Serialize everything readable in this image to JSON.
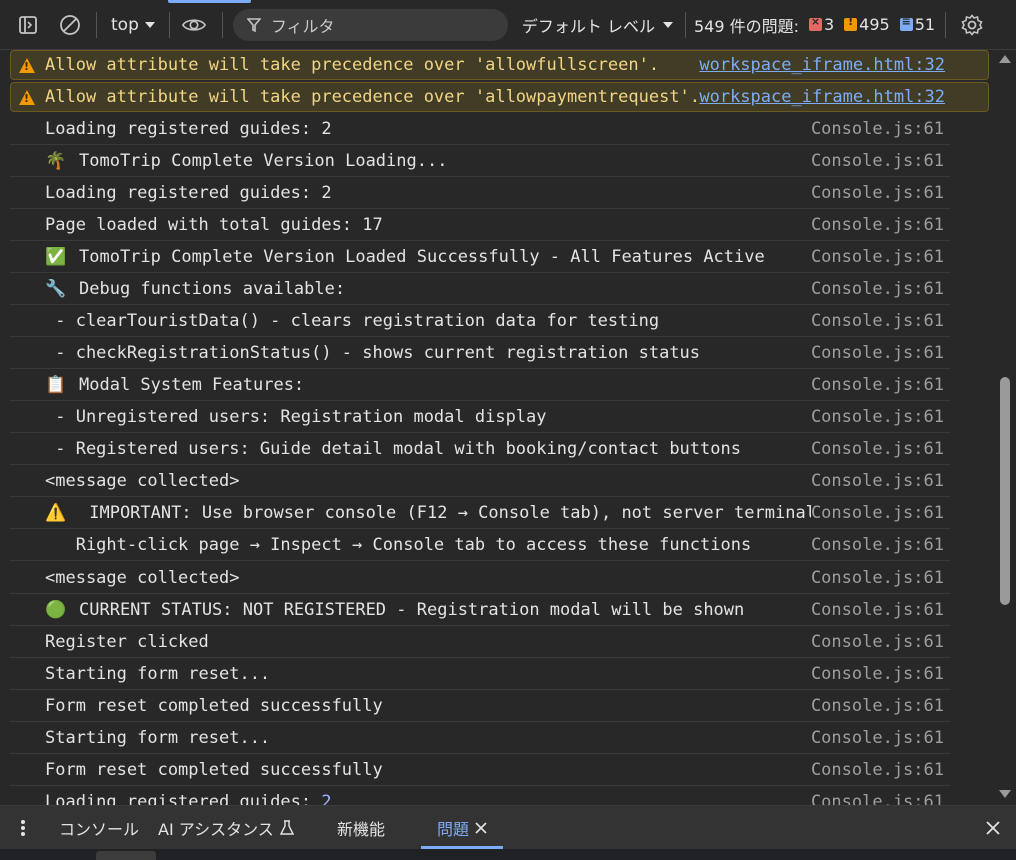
{
  "toolbar": {
    "context": "top",
    "filter_placeholder": "フィルタ",
    "level_label": "デフォルト レベル",
    "issues_label": "549 件の問題:",
    "issue_counts": {
      "error": "3",
      "warning": "495",
      "info": "51"
    }
  },
  "console": {
    "rows": [
      {
        "type": "warn",
        "text": "Allow attribute will take precedence over 'allowfullscreen'.",
        "source": "workspace_iframe.html:32"
      },
      {
        "type": "warn",
        "text": "Allow attribute will take precedence over 'allowpaymentrequest'.",
        "source": "workspace_iframe.html:32"
      },
      {
        "type": "log",
        "text": "Loading registered guides: 2",
        "source": "Console.js:61"
      },
      {
        "type": "log",
        "emoji": "🌴",
        "text": "TomoTrip Complete Version Loading...",
        "source": "Console.js:61"
      },
      {
        "type": "log",
        "text": "Loading registered guides: 2",
        "source": "Console.js:61"
      },
      {
        "type": "log",
        "text": "Page loaded with total guides: 17",
        "source": "Console.js:61"
      },
      {
        "type": "log",
        "emoji": "✅",
        "text": "TomoTrip Complete Version Loaded Successfully - All Features Active",
        "source": "Console.js:61"
      },
      {
        "type": "log",
        "emoji": "🔧",
        "text": "Debug functions available:",
        "source": "Console.js:61"
      },
      {
        "type": "log",
        "text": " - clearTouristData() - clears registration data for testing",
        "source": "Console.js:61"
      },
      {
        "type": "log",
        "text": " - checkRegistrationStatus() - shows current registration status",
        "source": "Console.js:61"
      },
      {
        "type": "log",
        "emoji": "📋",
        "text": "Modal System Features:",
        "source": "Console.js:61"
      },
      {
        "type": "log",
        "text": " - Unregistered users: Registration modal display",
        "source": "Console.js:61"
      },
      {
        "type": "log",
        "text": " - Registered users: Guide detail modal with booking/contact buttons",
        "source": "Console.js:61"
      },
      {
        "type": "log",
        "text": "<message collected>",
        "source": "Console.js:61"
      },
      {
        "type": "log",
        "emoji": "⚠️",
        "text": " IMPORTANT: Use browser console (F12 → Console tab), not server terminal",
        "source": "Console.js:61"
      },
      {
        "type": "log",
        "text": "   Right-click page → Inspect → Console tab to access these functions",
        "source": "Console.js:61"
      },
      {
        "type": "log",
        "text": "<message collected>",
        "source": "Console.js:61"
      },
      {
        "type": "log",
        "emoji": "🟢",
        "text": "CURRENT STATUS: NOT REGISTERED - Registration modal will be shown",
        "source": "Console.js:61"
      },
      {
        "type": "log",
        "text": "Register clicked",
        "source": "Console.js:61"
      },
      {
        "type": "log",
        "text": "Starting form reset...",
        "source": "Console.js:61"
      },
      {
        "type": "log",
        "text": "Form reset completed successfully",
        "source": "Console.js:61"
      },
      {
        "type": "log",
        "text": "Starting form reset...",
        "source": "Console.js:61"
      },
      {
        "type": "log",
        "text": "Form reset completed successfully",
        "source": "Console.js:61"
      },
      {
        "type": "log",
        "text": "Loading registered guides: ",
        "number": "2",
        "source": "Console.js:61"
      }
    ]
  },
  "drawer": {
    "tabs": [
      {
        "label": "コンソール"
      },
      {
        "label": "AI アシスタンス"
      },
      {
        "label": "新機能"
      },
      {
        "label": "問題"
      }
    ]
  }
}
